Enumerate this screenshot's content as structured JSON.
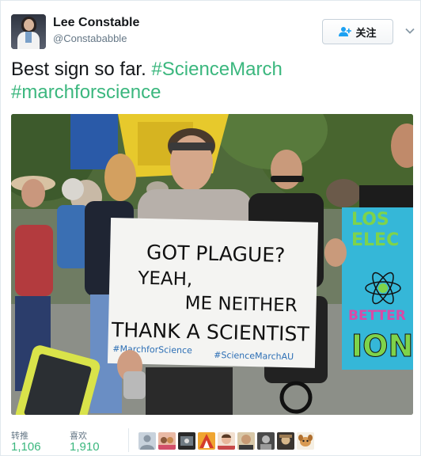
{
  "user": {
    "name": "Lee Constable",
    "handle": "@Constababble"
  },
  "follow_button": {
    "label": "关注",
    "icon": "add-user-icon"
  },
  "menu_icon": "chevron-down-icon",
  "tweet": {
    "text_plain": "Best sign so far. ",
    "hashtags": [
      "#ScienceMarch",
      "#marchforscience"
    ]
  },
  "photo_sign": {
    "line1": "GOT PLAGUE?",
    "line2": "YEAH,",
    "line3": "ME NEITHER",
    "line4": "THANK A SCIENTIST",
    "tag1": "#MarchforScience",
    "tag2": "#ScienceMarchAU"
  },
  "photo_side_sign": {
    "line1": "LOS",
    "line2": "ELEC",
    "line3": "BETTER",
    "line4": "ION"
  },
  "stats": {
    "retweets_label": "转推",
    "retweets_count": "1,106",
    "likes_label": "喜欢",
    "likes_count": "1,910"
  },
  "colors": {
    "hashtag": "#3bb77e",
    "text": "#14171a",
    "muted": "#657786"
  }
}
